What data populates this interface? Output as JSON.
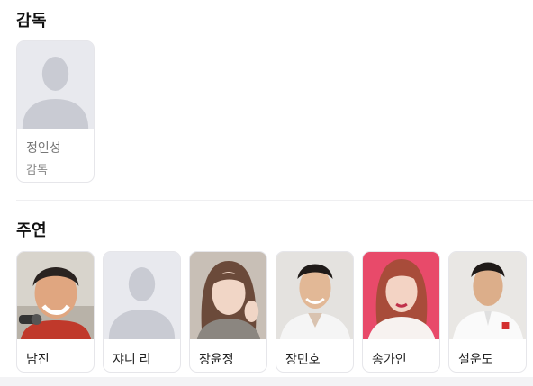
{
  "director_section": {
    "title": "감독",
    "people": [
      {
        "name": "정인성",
        "role": "감독",
        "photo": "placeholder-silhouette"
      }
    ]
  },
  "cast_section": {
    "title": "주연",
    "people": [
      {
        "name": "남진",
        "photo": "person-photo"
      },
      {
        "name": "쟈니 리",
        "photo": "placeholder-silhouette"
      },
      {
        "name": "장윤정",
        "photo": "person-photo"
      },
      {
        "name": "장민호",
        "photo": "person-photo"
      },
      {
        "name": "송가인",
        "photo": "person-photo"
      },
      {
        "name": "설운도",
        "photo": "person-photo"
      }
    ]
  },
  "colors": {
    "placeholder_bg": "#e8e9ee",
    "placeholder_silhouette": "#c9cbd3",
    "card_border": "#e6e6ea"
  }
}
